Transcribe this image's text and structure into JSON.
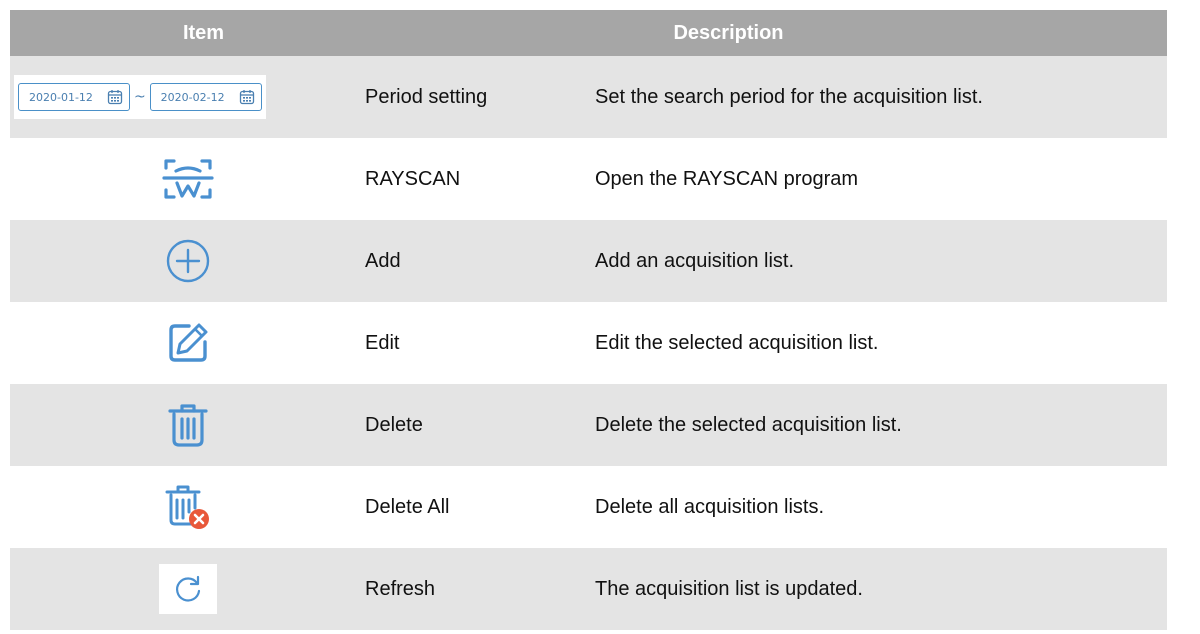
{
  "header": {
    "item": "Item",
    "description": "Description"
  },
  "period": {
    "start": "2020-01-12",
    "separator": "~",
    "end": "2020-02-12"
  },
  "rows": [
    {
      "name": "Period setting",
      "description": "Set the search period for the acquisition list.",
      "icon": "date-range-picker"
    },
    {
      "name": "RAYSCAN",
      "description": "Open the RAYSCAN program",
      "icon": "rayscan-tooth-icon"
    },
    {
      "name": "Add",
      "description": "Add an acquisition list.",
      "icon": "plus-circle-icon"
    },
    {
      "name": "Edit",
      "description": "Edit the selected acquisition list.",
      "icon": "edit-icon"
    },
    {
      "name": "Delete",
      "description": "Delete the selected acquisition list.",
      "icon": "trash-icon"
    },
    {
      "name": "Delete All",
      "description": "Delete all acquisition lists.",
      "icon": "trash-delete-all-icon"
    },
    {
      "name": "Refresh",
      "description": "The acquisition list is updated.",
      "icon": "refresh-icon"
    }
  ],
  "colors": {
    "header_bg": "#a6a6a6",
    "alt_row_bg": "#e4e4e4",
    "icon_blue": "#4a90d0",
    "delete_badge": "#e8583a"
  }
}
